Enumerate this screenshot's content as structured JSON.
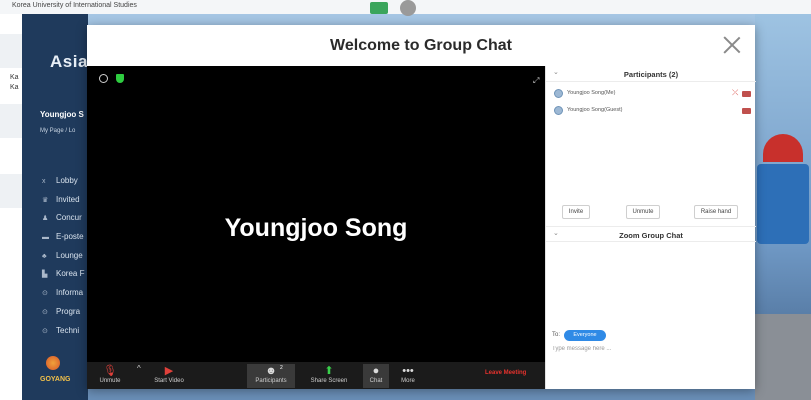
{
  "background": {
    "top_text": "Korea University of International Studies",
    "left_texts": [
      "Ka",
      "Ka"
    ],
    "brand": "Asia",
    "user_name": "Youngjoo S",
    "breadcrumb": "My Page  /  Lo",
    "menu": [
      {
        "icon": "x",
        "label": "Lobby"
      },
      {
        "icon": "♛",
        "label": "Invited"
      },
      {
        "icon": "♟",
        "label": "Concur"
      },
      {
        "icon": "▬",
        "label": "E-poste"
      },
      {
        "icon": "♣",
        "label": "Lounge"
      },
      {
        "icon": "▙",
        "label": "Korea F"
      },
      {
        "icon": "⊙",
        "label": "Informa"
      },
      {
        "icon": "⊙",
        "label": "Progra"
      },
      {
        "icon": "⊙",
        "label": "Techni"
      }
    ],
    "logo_text": "GOYANG"
  },
  "modal": {
    "title": "Welcome to Group Chat"
  },
  "video": {
    "speaker_name": "Youngjoo Song",
    "expand_glyph": "⤢"
  },
  "toolbar": {
    "unmute": "Unmute",
    "start_video": "Start Video",
    "participants": "Participants",
    "participant_count": "2",
    "share_screen": "Share Screen",
    "chat": "Chat",
    "more": "More",
    "leave": "Leave Meeting"
  },
  "participants": {
    "title": "Participants (2)",
    "list": [
      {
        "name": "Youngjoo Song(Me)"
      },
      {
        "name": "Youngjoo Song(Guest)"
      }
    ],
    "buttons": {
      "invite": "Invite",
      "unmute": "Unmute",
      "raise_hand": "Raise hand"
    }
  },
  "chat": {
    "title": "Zoom Group Chat",
    "to_label": "To:",
    "recipient": "Everyone",
    "input_placeholder": "Type message here ..."
  }
}
